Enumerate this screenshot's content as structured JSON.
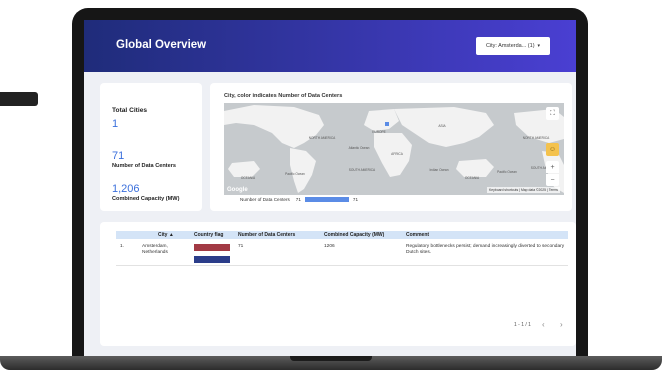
{
  "header": {
    "title": "Global Overview",
    "filter_label": "City: Amsterda... (1)",
    "filter_arrow": "▾"
  },
  "stats": {
    "total_cities_label": "Total Cities",
    "total_cities_value": "1",
    "datacenters_value": "71",
    "datacenters_label": "Number of Data Centers",
    "capacity_value": "1,206",
    "capacity_label": "Combined Capacity (MW)"
  },
  "map": {
    "title": "City, color indicates Number of Data Centers",
    "legend_label": "Number of Data Centers",
    "legend_min": "71",
    "legend_max": "71",
    "attribution": "Keyboard shortcuts  |  Map data ©2025  |  Terms",
    "logo": "Google",
    "fullscreen_icon": "⛶",
    "pegman_icon": "☺",
    "zoom_in": "+",
    "zoom_out": "−",
    "labels": {
      "north_america": "NORTH AMERICA",
      "south_america": "SOUTH AMERICA",
      "europe": "EUROPE",
      "africa": "AFRICA",
      "asia": "ASIA",
      "oceania_left": "OCEANIA",
      "oceania_right": "OCEANIA",
      "north_america_right": "NORTH AMERICA",
      "south_america_right": "SOUTH AMERICA",
      "atlantic": "Atlantic Ocean",
      "pacific": "Pacific Ocean",
      "indian": "Indian Ocean",
      "pacific_right": "Pacific Ocean"
    }
  },
  "table": {
    "columns": [
      "City",
      "Country flag",
      "Number of Data Centers",
      "Combined Capacity (MW)",
      "Comment"
    ],
    "sort_indicator": "▲",
    "rows": [
      {
        "index": "1.",
        "city": "Amsterdam, Netherlands",
        "datacenters": "71",
        "capacity": "1206",
        "comment": "Regulatory bottlenecks persist; demand increasingly diverted to secondary Dutch sites."
      }
    ],
    "pagination": "1 - 1 / 1",
    "prev": "‹",
    "next": "›"
  },
  "colors": {
    "header_start": "#1f2c7a",
    "header_end": "#4a3fd2",
    "accent": "#3a6fdc",
    "legend_bar": "#5b8ce6"
  }
}
